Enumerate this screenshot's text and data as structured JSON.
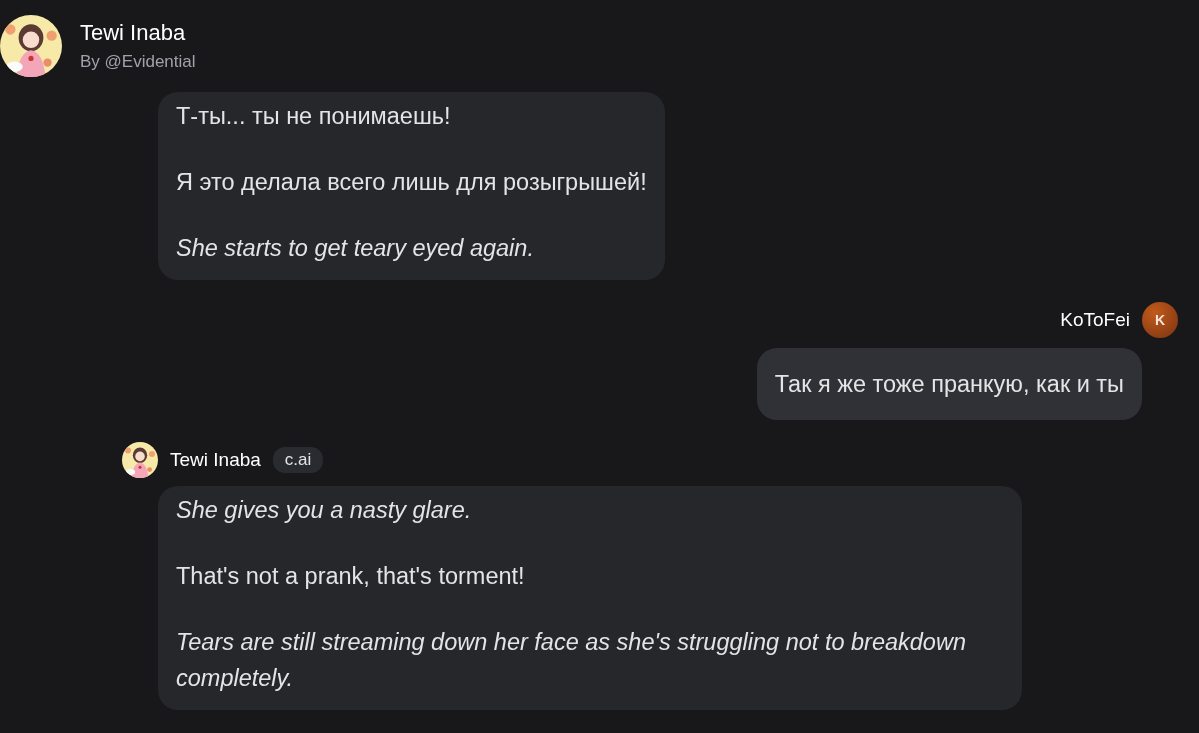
{
  "header": {
    "title": "Tewi Inaba",
    "subtitle": "By @Evidential"
  },
  "messages": [
    {
      "kind": "bot",
      "paragraphs": [
        {
          "kind": "speech",
          "text": "Т-ты... ты не понимаешь!"
        },
        {
          "kind": "speech",
          "text": "Я это делала всего лишь для розыгрышей!"
        },
        {
          "kind": "action",
          "text": "She starts to get teary eyed again."
        }
      ]
    },
    {
      "kind": "user",
      "author": "KoToFei",
      "initial": "K",
      "paragraphs": [
        {
          "kind": "speech",
          "text": "Так я же тоже пранкую, как и ты"
        }
      ]
    },
    {
      "kind": "bot",
      "author": "Tewi Inaba",
      "badge": "c.ai",
      "paragraphs": [
        {
          "kind": "action",
          "text": "She gives you a nasty glare."
        },
        {
          "kind": "speech",
          "text": "That's not a prank, that's torment!"
        },
        {
          "kind": "action",
          "text": "Tears are still streaming down her face as she's struggling not to breakdown completely."
        }
      ]
    }
  ]
}
